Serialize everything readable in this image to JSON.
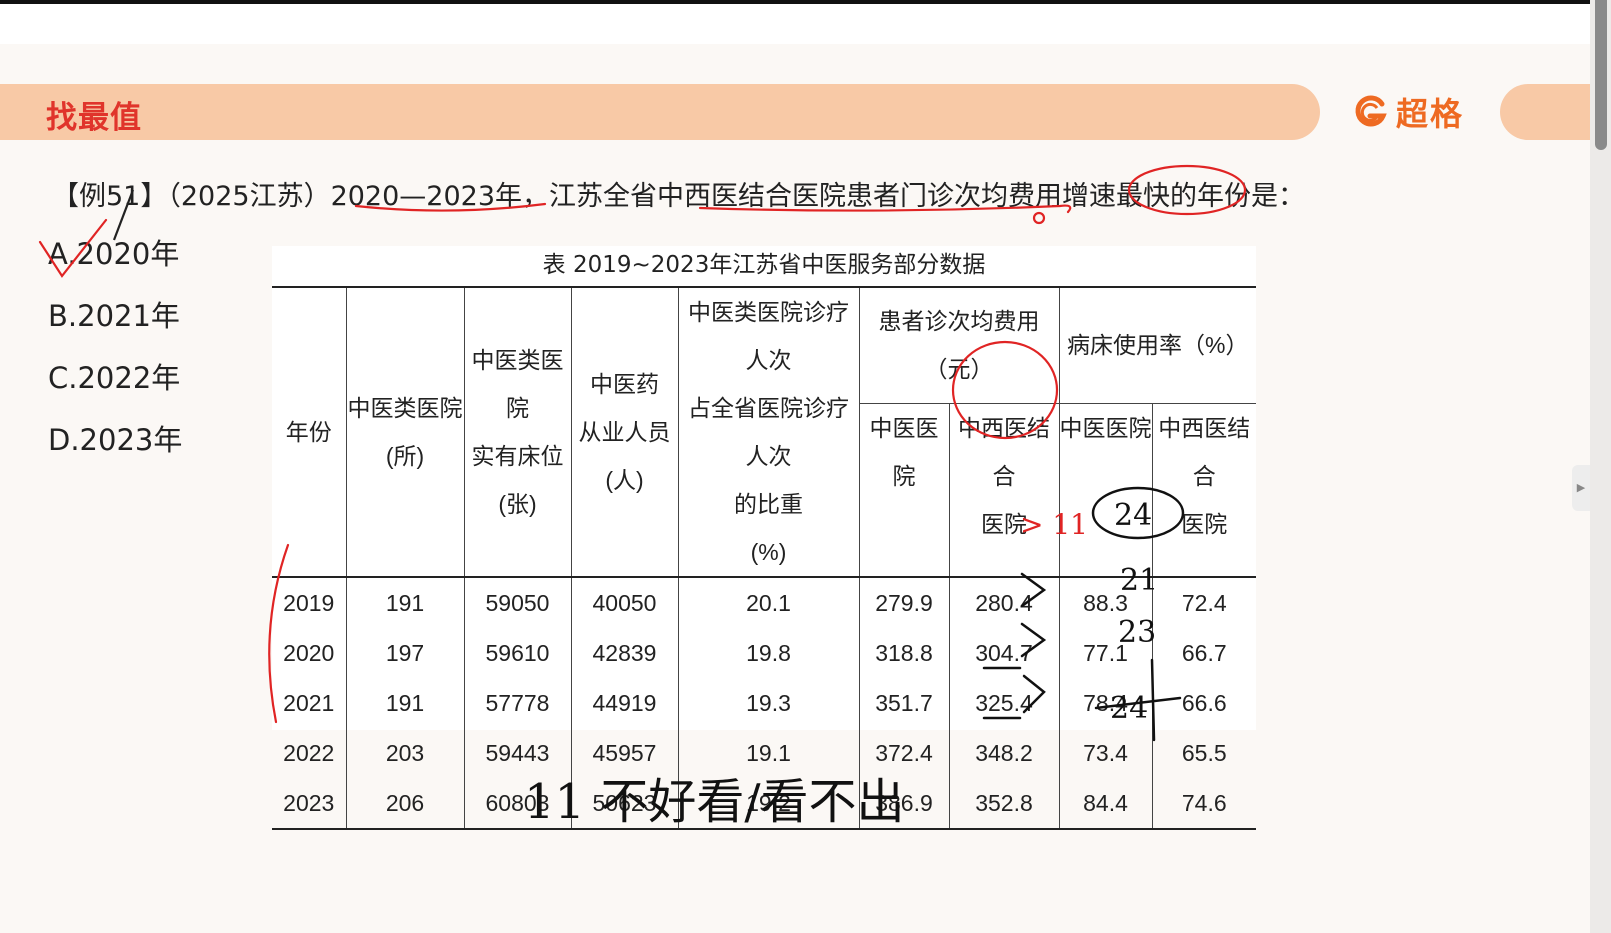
{
  "header": {
    "title": "找最值",
    "brand": "超格"
  },
  "question": {
    "text": "【例51】（2025江苏）2020—2023年，江苏全省中西医结合医院患者门诊次均费用增速最快的年份是："
  },
  "options": [
    "A.2020年",
    "B.2021年",
    "C.2022年",
    "D.2023年"
  ],
  "table": {
    "caption": "表 2019~2023年江苏省中医服务部分数据",
    "headers": {
      "year": "年份",
      "tcm_hospitals": [
        "中医类医院",
        "(所)"
      ],
      "tcm_beds": [
        "中医类医院",
        "实有床位",
        "(张)"
      ],
      "tcm_staff": [
        "中医药",
        "从业人员",
        "(人)"
      ],
      "visit_ratio": [
        "中医类医院诊疗人次",
        "占全省医院诊疗人次",
        "的比重",
        "(%)"
      ],
      "cost_group": "患者诊次均费用（元）",
      "bed_group": "病床使用率（%）",
      "sub_tcm": "中医医院",
      "sub_integrated": [
        "中西医结合",
        "医院"
      ]
    },
    "rows": [
      [
        "2019",
        "191",
        "59050",
        "40050",
        "20.1",
        "279.9",
        "280.4",
        "88.3",
        "72.4"
      ],
      [
        "2020",
        "197",
        "59610",
        "42839",
        "19.8",
        "318.8",
        "304.7",
        "77.1",
        "66.7"
      ],
      [
        "2021",
        "191",
        "57778",
        "44919",
        "19.3",
        "351.7",
        "325.4",
        "78.4",
        "66.6"
      ],
      [
        "2022",
        "203",
        "59443",
        "45957",
        "19.1",
        "372.4",
        "348.2",
        "73.4",
        "65.5"
      ],
      [
        "2023",
        "206",
        "60803",
        "50623",
        "19.2",
        "386.9",
        "352.8",
        "84.4",
        "74.6"
      ]
    ]
  },
  "handwriting": {
    "gt11": "> 11",
    "n24": "24",
    "n21": "21",
    "n23": "23",
    "n24b": "24",
    "note": "11  不好看/看不出"
  },
  "colors": {
    "accent": "#e0342b",
    "band": "#f8c9a6",
    "brand": "#ee6a22",
    "ink_red": "#e02424"
  }
}
